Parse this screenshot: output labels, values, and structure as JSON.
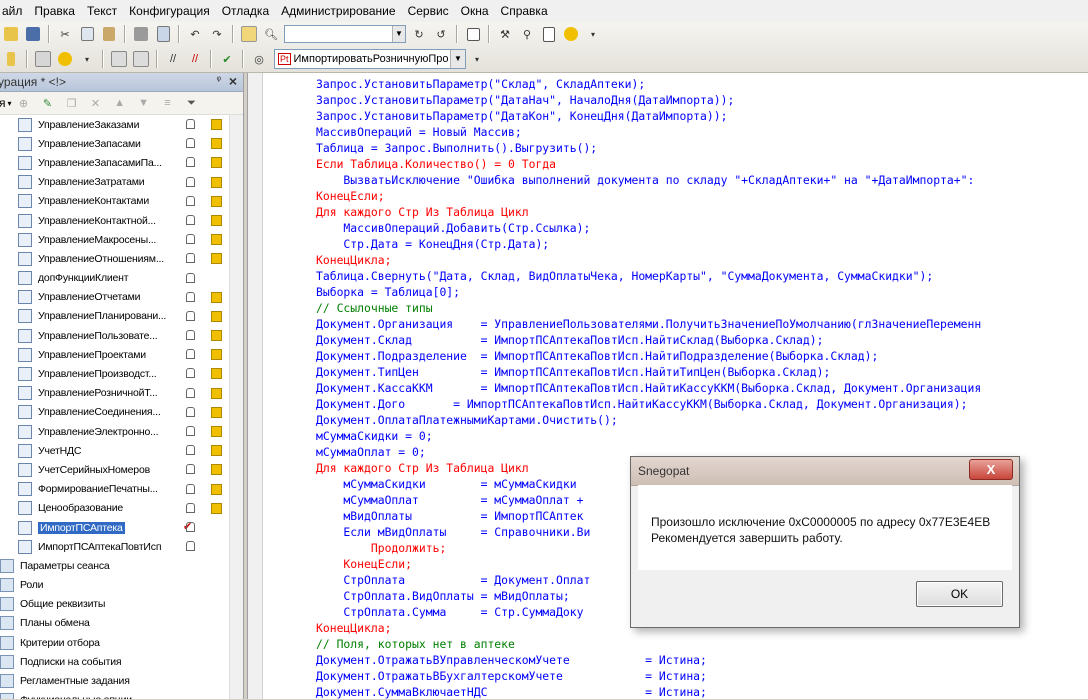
{
  "menu": [
    "айл",
    "Правка",
    "Текст",
    "Конфигурация",
    "Отладка",
    "Администрирование",
    "Сервис",
    "Окна",
    "Справка"
  ],
  "toolbar": {
    "module_selector": "ИмпортироватьРозничнуюПро"
  },
  "left_panel": {
    "title": "урация * <!>",
    "toolbar_label": "я"
  },
  "tree_items": [
    {
      "label": "УправлениеЗаказами",
      "cube": true
    },
    {
      "label": "УправлениеЗапасами",
      "cube": true
    },
    {
      "label": "УправлениеЗапасамиПа...",
      "cube": true
    },
    {
      "label": "УправлениеЗатратами",
      "cube": true
    },
    {
      "label": "УправлениеКонтактами",
      "cube": true
    },
    {
      "label": "УправлениеКонтактной...",
      "cube": true
    },
    {
      "label": "УправлениеМакросены...",
      "cube": true
    },
    {
      "label": "УправлениеОтношениям...",
      "cube": true
    },
    {
      "label": "допФункцииКлиент",
      "cube": false
    },
    {
      "label": "УправлениеОтчетами",
      "cube": true
    },
    {
      "label": "УправлениеПланировани...",
      "cube": true
    },
    {
      "label": "УправлениеПользовате...",
      "cube": true
    },
    {
      "label": "УправлениеПроектами",
      "cube": true
    },
    {
      "label": "УправлениеПроизводст...",
      "cube": true
    },
    {
      "label": "УправлениеРозничнойТ...",
      "cube": true
    },
    {
      "label": "УправлениеСоединения...",
      "cube": true
    },
    {
      "label": "УправлениеЭлектронно...",
      "cube": true
    },
    {
      "label": "УчетНДС",
      "cube": true
    },
    {
      "label": "УчетСерийныхНомеров",
      "cube": true
    },
    {
      "label": "ФормированиеПечатны...",
      "cube": true
    },
    {
      "label": "Ценообразование",
      "cube": true
    },
    {
      "label": "ИмпортПСАптека",
      "cube": false,
      "selected": true
    },
    {
      "label": "ИмпортПСАптекаПовтИсп",
      "cube": false
    },
    {
      "label": "Параметры сеанса",
      "cube": false,
      "root": true
    },
    {
      "label": "Роли",
      "cube": false,
      "root": true
    },
    {
      "label": "Общие реквизиты",
      "cube": false,
      "root": true
    },
    {
      "label": "Планы обмена",
      "cube": false,
      "root": true
    },
    {
      "label": "Критерии отбора",
      "cube": false,
      "root": true
    },
    {
      "label": "Подписки на события",
      "cube": false,
      "root": true
    },
    {
      "label": "Регламентные задания",
      "cube": false,
      "root": true
    },
    {
      "label": "Функциональные опции",
      "cube": false,
      "root": true
    }
  ],
  "code_lines": [
    {
      "t": "Запрос.УстановитьПараметр(\"Склад\", СкладАптеки);",
      "c": "n"
    },
    {
      "t": "Запрос.УстановитьПараметр(\"ДатаНач\", НачалоДня(ДатаИмпорта));",
      "c": "n"
    },
    {
      "t": "Запрос.УстановитьПараметр(\"ДатаКон\", КонецДня(ДатаИмпорта));",
      "c": "n"
    },
    {
      "t": "МассивОпераций = Новый Массив;",
      "c": "n"
    },
    {
      "t": "Таблица = Запрос.Выполнить().Выгрузить();",
      "c": "n"
    },
    {
      "t": "Если Таблица.Количество() = 0 Тогда",
      "c": "k"
    },
    {
      "t": "    ВызватьИсключение \"Ошибка выполнений документа по складу \"+СкладАптеки+\" на \"+ДатаИмпорта+\":",
      "c": "n"
    },
    {
      "t": "КонецЕсли;",
      "c": "k"
    },
    {
      "t": "Для каждого Стр Из Таблица Цикл",
      "c": "k"
    },
    {
      "t": "    МассивОпераций.Добавить(Стр.Ссылка);",
      "c": "n"
    },
    {
      "t": "    Стр.Дата = КонецДня(Стр.Дата);",
      "c": "n"
    },
    {
      "t": "КонецЦикла;",
      "c": "k"
    },
    {
      "t": "Таблица.Свернуть(\"Дата, Склад, ВидОплатыЧека, НомерКарты\", \"СуммаДокумента, СуммаСкидки\");",
      "c": "n"
    },
    {
      "t": "Выборка = Таблица[0];",
      "c": "n"
    },
    {
      "t": "// Ссылочные типы",
      "c": "c"
    },
    {
      "t": "Документ.Организация    = УправлениеПользователями.ПолучитьЗначениеПоУмолчанию(глЗначениеПеременн",
      "c": "n"
    },
    {
      "t": "Документ.Склад          = ИмпортПСАптекаПовтИсп.НайтиСклад(Выборка.Склад);",
      "c": "n"
    },
    {
      "t": "Документ.Подразделение  = ИмпортПСАптекаПовтИсп.НайтиПодразделение(Выборка.Склад);",
      "c": "n"
    },
    {
      "t": "Документ.ТипЦен         = ИмпортПСАптекаПовтИсп.НайтиТипЦен(Выборка.Склад);",
      "c": "n"
    },
    {
      "t": "Документ.КассаККМ       = ИмпортПСАптекаПовтИсп.НайтиКассуККМ(Выборка.Склад, Документ.Организация",
      "c": "n"
    },
    {
      "t": "Документ.Дого       = ИмпортПСАптекаПовтИсп.НайтиКассуККМ(Выборка.Склад, Документ.Организация);",
      "c": "n"
    },
    {
      "t": "Документ.ОплатаПлатежнымиКартами.Очистить();",
      "c": "n"
    },
    {
      "t": "мСуммаСкидки = 0;",
      "c": "n"
    },
    {
      "t": "мСуммаОплат = 0;",
      "c": "n"
    },
    {
      "t": "Для каждого Стр Из Таблица Цикл",
      "c": "k"
    },
    {
      "t": "    мСуммаСкидки        = мСуммаСкидки",
      "c": "n"
    },
    {
      "t": "    мСуммаОплат         = мСуммаОплат +",
      "c": "n"
    },
    {
      "t": "    мВидОплаты          = ИмпортПСАптек",
      "c": "n"
    },
    {
      "t": "    Если мВидОплаты     = Справочники.Ви",
      "c": "n"
    },
    {
      "t": "        Продолжить;",
      "c": "k"
    },
    {
      "t": "    КонецЕсли;",
      "c": "k"
    },
    {
      "t": "    СтрОплата           = Документ.Оплат",
      "c": "n"
    },
    {
      "t": "    СтрОплата.ВидОплаты = мВидОплаты;",
      "c": "n"
    },
    {
      "t": "    СтрОплата.Сумма     = Стр.СуммаДоку",
      "c": "n"
    },
    {
      "t": "КонецЦикла;",
      "c": "k"
    },
    {
      "t": "// Поля, которых нет в аптеке",
      "c": "c"
    },
    {
      "t": "Документ.ОтражатьВУправленческомУчете           = Истина;",
      "c": "n"
    },
    {
      "t": "Документ.ОтражатьВБухгалтерскомУчете            = Истина;",
      "c": "n"
    },
    {
      "t": "Документ.СуммаВключаетНДС                       = Истина;",
      "c": "n"
    }
  ],
  "dialog": {
    "title": "Snegopat",
    "close": "X",
    "line1": "Произошло исключение 0xC0000005 по адресу 0x77E3E4EB",
    "line2": "Рекомендуется завершить работу.",
    "ok_label": "OK"
  }
}
